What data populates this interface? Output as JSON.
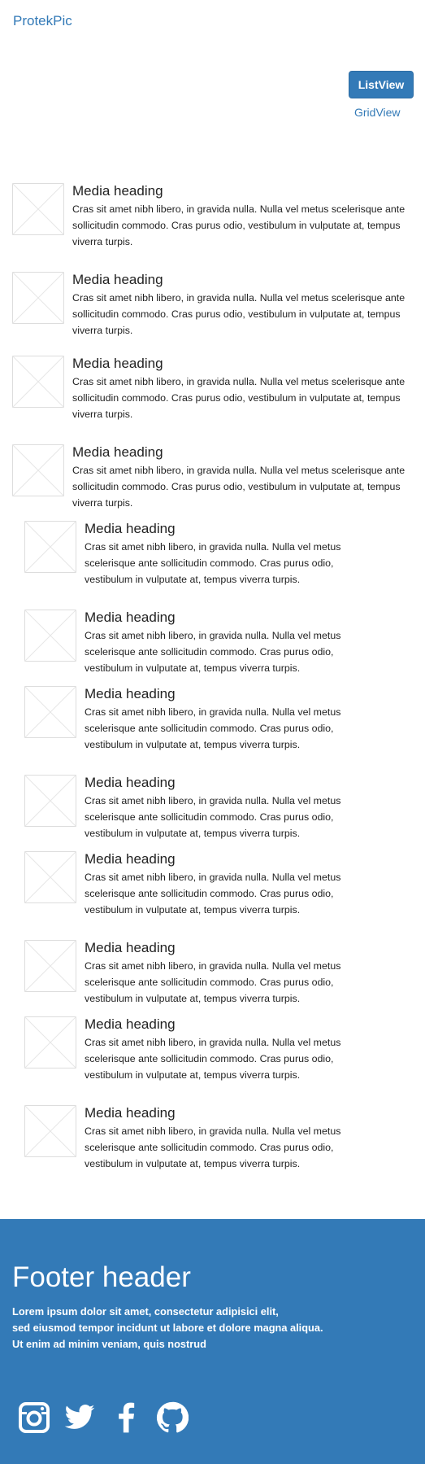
{
  "brand": "ProtekPic",
  "view_toggle": {
    "list_label": "ListView",
    "grid_label": "GridView"
  },
  "media_items": [
    {
      "heading": "Media heading",
      "text": "Cras sit amet nibh libero, in gravida nulla. Nulla vel metus scelerisque ante sollicitudin commodo. Cras purus odio, vestibulum in vulputate at, tempus viverra turpis."
    },
    {
      "heading": "Media heading",
      "text": "Cras sit amet nibh libero, in gravida nulla. Nulla vel metus scelerisque ante sollicitudin commodo. Cras purus odio, vestibulum in vulputate at, tempus viverra turpis."
    },
    {
      "heading": "Media heading",
      "text": "Cras sit amet nibh libero, in gravida nulla. Nulla vel metus scelerisque ante sollicitudin commodo. Cras purus odio, vestibulum in vulputate at, tempus viverra turpis."
    },
    {
      "heading": "Media heading",
      "text": "Cras sit amet nibh libero, in gravida nulla. Nulla vel metus scelerisque ante sollicitudin commodo. Cras purus odio, vestibulum in vulputate at, tempus viverra turpis."
    },
    {
      "heading": "Media heading",
      "text": "Cras sit amet nibh libero, in gravida nulla. Nulla vel metus scelerisque ante sollicitudin commodo. Cras purus odio, vestibulum in vulputate at, tempus viverra turpis."
    },
    {
      "heading": "Media heading",
      "text": "Cras sit amet nibh libero, in gravida nulla. Nulla vel metus scelerisque ante sollicitudin commodo. Cras purus odio, vestibulum in vulputate at, tempus viverra turpis."
    },
    {
      "heading": "Media heading",
      "text": "Cras sit amet nibh libero, in gravida nulla. Nulla vel metus scelerisque ante sollicitudin commodo. Cras purus odio, vestibulum in vulputate at, tempus viverra turpis."
    },
    {
      "heading": "Media heading",
      "text": "Cras sit amet nibh libero, in gravida nulla. Nulla vel metus scelerisque ante sollicitudin commodo. Cras purus odio, vestibulum in vulputate at, tempus viverra turpis."
    },
    {
      "heading": "Media heading",
      "text": "Cras sit amet nibh libero, in gravida nulla. Nulla vel metus scelerisque ante sollicitudin commodo. Cras purus odio, vestibulum in vulputate at, tempus viverra turpis."
    },
    {
      "heading": "Media heading",
      "text": "Cras sit amet nibh libero, in gravida nulla. Nulla vel metus scelerisque ante sollicitudin commodo. Cras purus odio, vestibulum in vulputate at, tempus viverra turpis."
    },
    {
      "heading": "Media heading",
      "text": "Cras sit amet nibh libero, in gravida nulla. Nulla vel metus scelerisque ante sollicitudin commodo. Cras purus odio, vestibulum in vulputate at, tempus viverra turpis."
    },
    {
      "heading": "Media heading",
      "text": "Cras sit amet nibh libero, in gravida nulla. Nulla vel metus scelerisque ante sollicitudin commodo. Cras purus odio, vestibulum in vulputate at, tempus viverra turpis."
    }
  ],
  "footer": {
    "title": "Footer header",
    "lines": [
      "Lorem ipsum dolor sit amet, consectetur adipisici elit,",
      "sed eiusmod tempor incidunt ut labore et dolore magna aliqua.",
      "Ut enim ad minim veniam, quis nostrud"
    ],
    "social_icons": [
      "instagram-icon",
      "twitter-icon",
      "facebook-icon",
      "github-icon"
    ]
  },
  "colors": {
    "primary": "#337ab7",
    "placeholder_border": "#dddddd"
  }
}
